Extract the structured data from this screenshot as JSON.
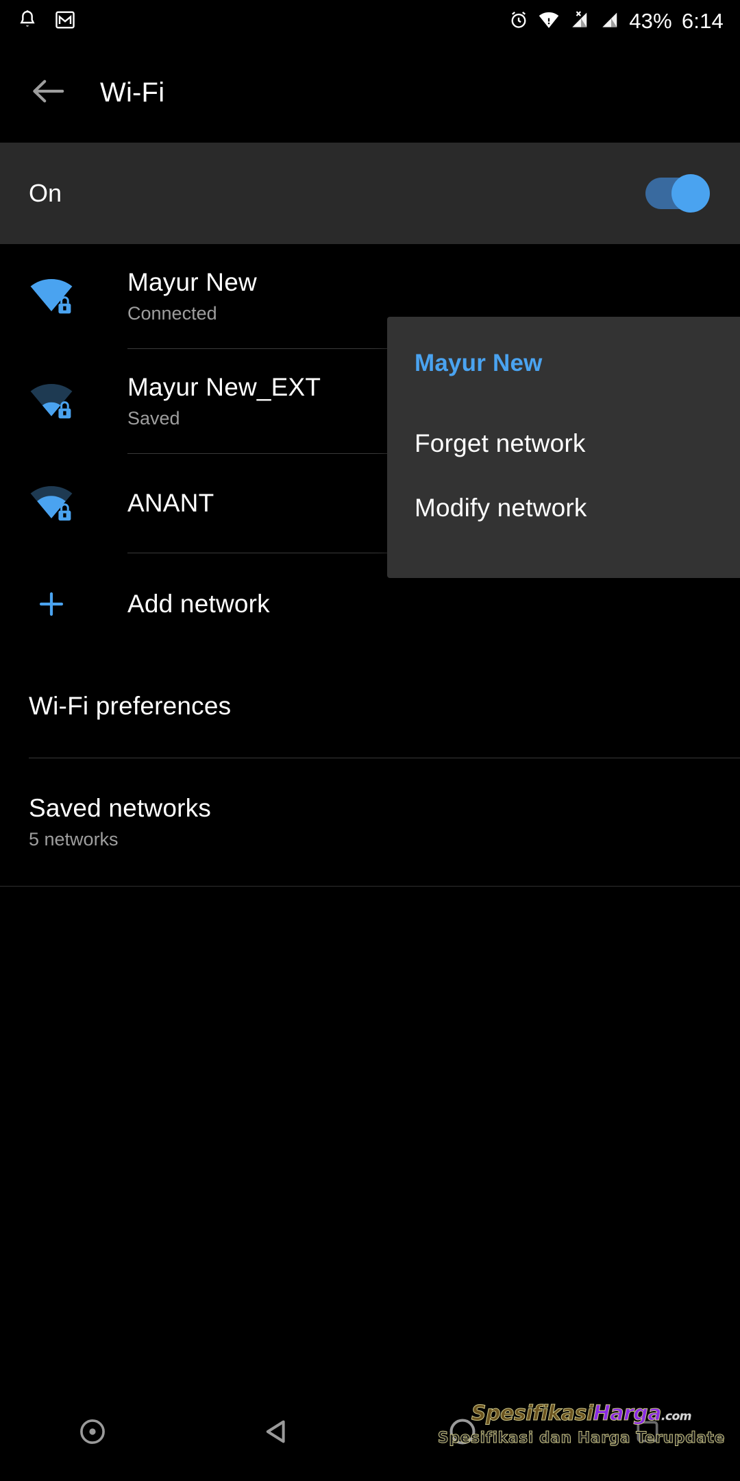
{
  "status_bar": {
    "left_icons": [
      "notification-bell-icon",
      "gmail-icon"
    ],
    "right_icons": [
      "alarm-icon",
      "wifi-icon",
      "signal-no-sim-icon",
      "signal-bars-icon"
    ],
    "battery_percent": "43%",
    "clock": "6:14"
  },
  "toolbar": {
    "back_icon": "back-arrow-icon",
    "title": "Wi-Fi"
  },
  "master_switch": {
    "label": "On",
    "state": "on",
    "accent_color": "#4aa3f0"
  },
  "networks": [
    {
      "ssid": "Mayur New",
      "status": "Connected",
      "signal": 4,
      "secured": true,
      "icon": "wifi-lock-icon"
    },
    {
      "ssid": "Mayur New_EXT",
      "status": "Saved",
      "signal": 1,
      "secured": true,
      "icon": "wifi-lock-icon"
    },
    {
      "ssid": "ANANT",
      "status": "",
      "signal": 2,
      "secured": true,
      "icon": "wifi-lock-icon"
    }
  ],
  "add_network": {
    "label": "Add network",
    "icon": "plus-icon"
  },
  "preferences": {
    "label": "Wi-Fi preferences"
  },
  "saved_networks": {
    "label": "Saved networks",
    "count_text": "5 networks"
  },
  "popup_menu": {
    "header": "Mayur New",
    "items": [
      {
        "label": "Forget network"
      },
      {
        "label": "Modify network"
      }
    ]
  },
  "nav_bar": {
    "buttons": [
      {
        "name": "screen-record-icon"
      },
      {
        "name": "back-triangle-icon"
      },
      {
        "name": "home-circle-icon"
      },
      {
        "name": "recents-square-icon"
      }
    ]
  },
  "watermark": {
    "brand_part1": "Spesifikasi",
    "brand_part2": "Harga",
    "brand_tld": ".com",
    "tagline": "Spesifikasi dan Harga Terupdate"
  }
}
